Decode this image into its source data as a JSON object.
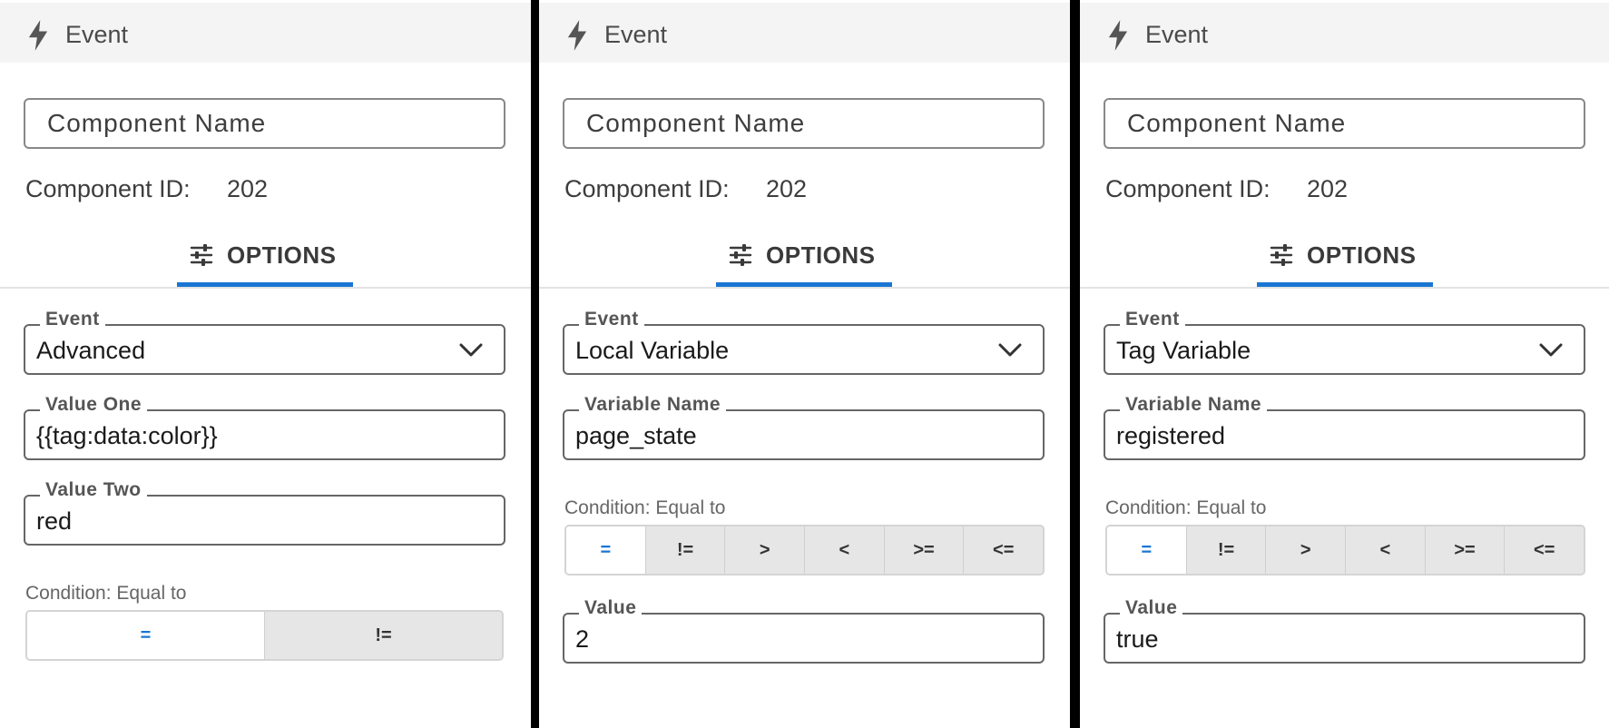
{
  "colors": {
    "accent": "#1976d2",
    "header_bg": "#f4f4f4",
    "divider": "#000000"
  },
  "icons": {
    "header": "lightning-bolt-icon",
    "options_tab": "sliders-icon",
    "select": "chevron-down-icon"
  },
  "panels": [
    {
      "header": {
        "title": "Event"
      },
      "component_name": {
        "placeholder": "Component Name"
      },
      "component_id": {
        "label": "Component ID:",
        "value": "202"
      },
      "tab": {
        "label": "OPTIONS"
      },
      "event_select": {
        "legend": "Event",
        "value": "Advanced"
      },
      "field_one": {
        "legend": "Value One",
        "value": "{{tag:data:color}}"
      },
      "field_two": {
        "legend": "Value Two",
        "value": "red"
      },
      "condition": {
        "label": "Condition: Equal to",
        "options": [
          "=",
          "!="
        ],
        "selected": "="
      }
    },
    {
      "header": {
        "title": "Event"
      },
      "component_name": {
        "placeholder": "Component Name"
      },
      "component_id": {
        "label": "Component ID:",
        "value": "202"
      },
      "tab": {
        "label": "OPTIONS"
      },
      "event_select": {
        "legend": "Event",
        "value": "Local Variable"
      },
      "field_one": {
        "legend": "Variable Name",
        "value": "page_state"
      },
      "condition": {
        "label": "Condition: Equal to",
        "options": [
          "=",
          "!=",
          ">",
          "<",
          ">=",
          "<="
        ],
        "selected": "="
      },
      "field_two": {
        "legend": "Value",
        "value": "2"
      }
    },
    {
      "header": {
        "title": "Event"
      },
      "component_name": {
        "placeholder": "Component Name"
      },
      "component_id": {
        "label": "Component ID:",
        "value": "202"
      },
      "tab": {
        "label": "OPTIONS"
      },
      "event_select": {
        "legend": "Event",
        "value": "Tag Variable"
      },
      "field_one": {
        "legend": "Variable Name",
        "value": "registered"
      },
      "condition": {
        "label": "Condition: Equal to",
        "options": [
          "=",
          "!=",
          ">",
          "<",
          ">=",
          "<="
        ],
        "selected": "="
      },
      "field_two": {
        "legend": "Value",
        "value": "true"
      }
    }
  ]
}
